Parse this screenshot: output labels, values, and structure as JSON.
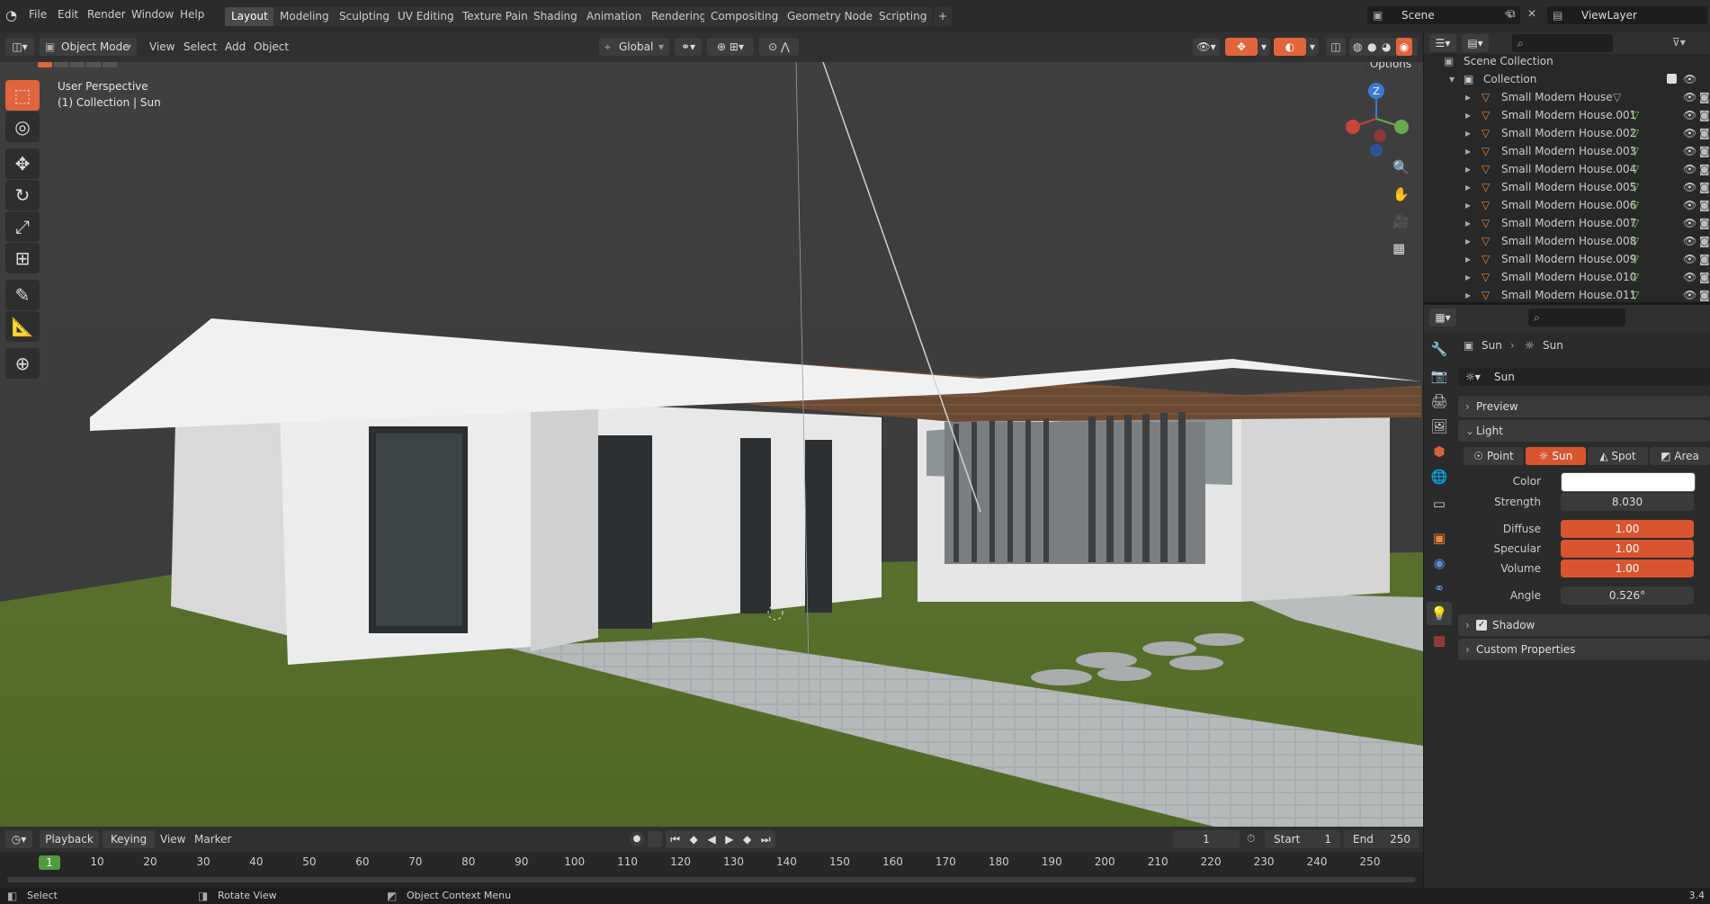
{
  "menus": [
    "File",
    "Edit",
    "Render",
    "Window",
    "Help"
  ],
  "workspace_tabs": [
    "Layout",
    "Modeling",
    "Sculpting",
    "UV Editing",
    "Texture Paint",
    "Shading",
    "Animation",
    "Rendering",
    "Compositing",
    "Geometry Nodes",
    "Scripting"
  ],
  "active_tab": "Layout",
  "scene_name": "Scene",
  "view_layer_name": "ViewLayer",
  "viewport_header": {
    "mode": "Object Mode",
    "menus": [
      "View",
      "Select",
      "Add",
      "Object"
    ],
    "transform_orientation": "Global",
    "options_label": "Options"
  },
  "viewport_overlay": {
    "perspective": "User Perspective",
    "context": "(1) Collection | Sun"
  },
  "gizmo": {
    "z": "Z"
  },
  "outliner": {
    "scene_collection": "Scene Collection",
    "collection": "Collection",
    "objects": [
      "Small Modern House",
      "Small Modern House.001",
      "Small Modern House.002",
      "Small Modern House.003",
      "Small Modern House.004",
      "Small Modern House.005",
      "Small Modern House.006",
      "Small Modern House.007",
      "Small Modern House.008",
      "Small Modern House.009",
      "Small Modern House.010",
      "Small Modern House.011"
    ]
  },
  "properties": {
    "breadcrumb_object": "Sun",
    "breadcrumb_data": "Sun",
    "datablock_name": "Sun",
    "panels": {
      "preview": "Preview",
      "light": "Light",
      "shadow": "Shadow",
      "custom": "Custom Properties"
    },
    "light_types": [
      "Point",
      "Sun",
      "Spot",
      "Area"
    ],
    "active_light_type": "Sun",
    "color_label": "Color",
    "color_value": "#ffffff",
    "strength_label": "Strength",
    "strength_value": "8.030",
    "diffuse_label": "Diffuse",
    "diffuse_value": "1.00",
    "specular_label": "Specular",
    "specular_value": "1.00",
    "volume_label": "Volume",
    "volume_value": "1.00",
    "angle_label": "Angle",
    "angle_value": "0.526°",
    "shadow_enabled": true
  },
  "timeline": {
    "menus": [
      "Playback",
      "Keying",
      "View",
      "Marker"
    ],
    "current_frame": "1",
    "start_label": "Start",
    "start_value": "1",
    "end_label": "End",
    "end_value": "250",
    "ruler": [
      "1",
      "10",
      "20",
      "30",
      "40",
      "50",
      "60",
      "70",
      "80",
      "90",
      "100",
      "110",
      "120",
      "130",
      "140",
      "150",
      "160",
      "170",
      "180",
      "190",
      "200",
      "210",
      "220",
      "230",
      "240",
      "250"
    ]
  },
  "statusbar": {
    "select": "Select",
    "rotate": "Rotate View",
    "context_menu": "Object Context Menu",
    "version": "3.4"
  },
  "colors": {
    "accent": "#4772b3",
    "active_orange": "#e1643c",
    "field_orange": "#d9552f"
  }
}
